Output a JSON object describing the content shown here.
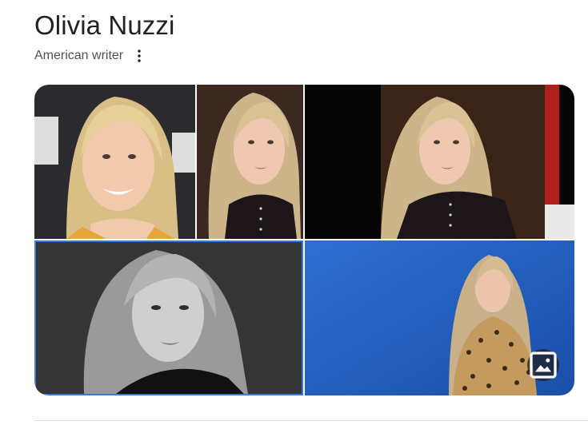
{
  "entity": {
    "title": "Olivia Nuzzi",
    "subtitle": "American writer"
  },
  "icons": {
    "more": "more-vert-icon",
    "images": "image-icon"
  },
  "colors": {
    "title": "#202124",
    "subtitle": "#4d5156",
    "selected_border": "#3b78e7",
    "badge_bg": "#202124"
  }
}
